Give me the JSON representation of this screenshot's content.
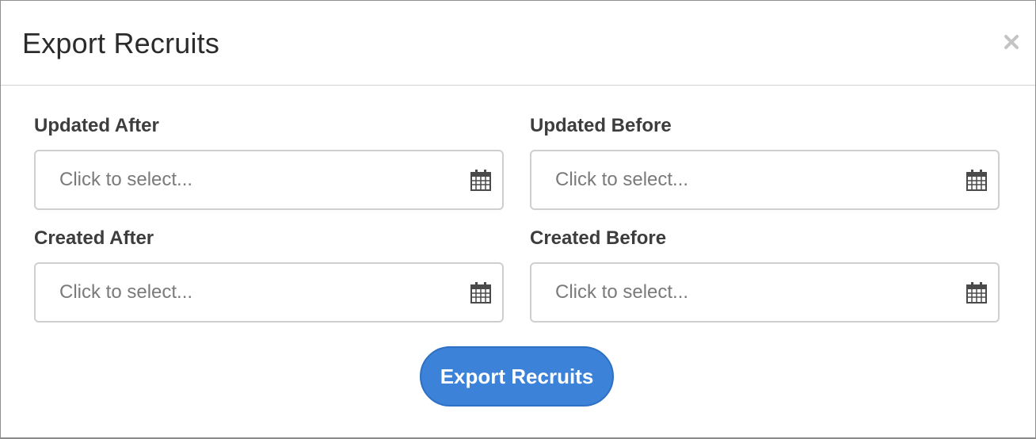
{
  "modal": {
    "title": "Export Recruits"
  },
  "fields": {
    "updated_after": {
      "label": "Updated After",
      "placeholder": "Click to select..."
    },
    "updated_before": {
      "label": "Updated Before",
      "placeholder": "Click to select..."
    },
    "created_after": {
      "label": "Created After",
      "placeholder": "Click to select..."
    },
    "created_before": {
      "label": "Created Before",
      "placeholder": "Click to select..."
    }
  },
  "actions": {
    "export_label": "Export Recruits"
  },
  "icons": {
    "close": "close-icon",
    "calendar": "calendar-icon"
  },
  "colors": {
    "accent": "#3b82d8",
    "label_text": "#3d3d3d",
    "input_border": "#cfcfcf"
  }
}
